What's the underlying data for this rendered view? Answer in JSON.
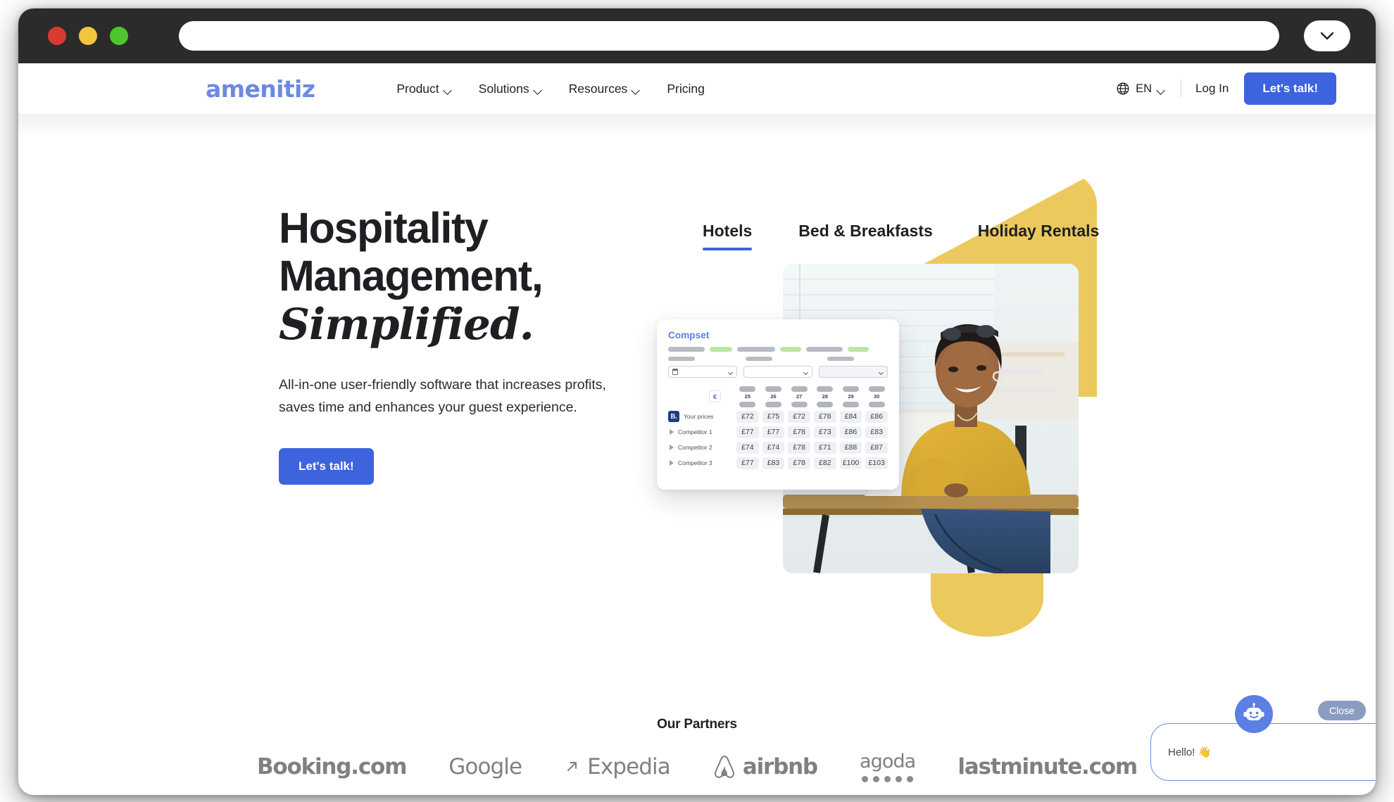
{
  "browser": {
    "traffic_lights": [
      "close",
      "minimize",
      "maximize"
    ],
    "url_value": "",
    "url_placeholder": "",
    "expand_icon": "chevron-down-icon"
  },
  "header": {
    "logo_text": "amenitiz",
    "nav": [
      {
        "label": "Product",
        "has_caret": true
      },
      {
        "label": "Solutions",
        "has_caret": true
      },
      {
        "label": "Resources",
        "has_caret": true
      },
      {
        "label": "Pricing",
        "has_caret": false
      }
    ],
    "language": {
      "icon": "globe-icon",
      "label": "EN",
      "has_caret": true
    },
    "login_label": "Log In",
    "cta_label": "Let's talk!"
  },
  "hero": {
    "headline_line1": "Hospitality",
    "headline_line2": "Management,",
    "headline_line3": "Simplified.",
    "subhead": "All-in-one user-friendly software that increases profits, saves time and enhances your guest experience.",
    "cta_label": "Let's talk!",
    "tabs": [
      {
        "label": "Hotels",
        "active": true
      },
      {
        "label": "Bed & Breakfasts",
        "active": false
      },
      {
        "label": "Holiday Rentals",
        "active": false
      }
    ]
  },
  "compset": {
    "title": "Compset",
    "currency_symbol": "€",
    "day_columns": [
      "25",
      "26",
      "27",
      "28",
      "29",
      "30"
    ],
    "rows": [
      {
        "label": "Your prices",
        "icon": "booking-b-logo",
        "prices": [
          "£72",
          "£75",
          "£72",
          "£78",
          "£84",
          "£86"
        ]
      },
      {
        "label": "Competitor 1",
        "icon": "triangle-expand-icon",
        "prices": [
          "£77",
          "£77",
          "£78",
          "£73",
          "£86",
          "£83"
        ]
      },
      {
        "label": "Competitor 2",
        "icon": "triangle-expand-icon",
        "prices": [
          "£74",
          "£74",
          "£78",
          "£71",
          "£88",
          "£87"
        ]
      },
      {
        "label": "Competitor 3",
        "icon": "triangle-expand-icon",
        "prices": [
          "£77",
          "£83",
          "£78",
          "£82",
          "£100",
          "£103"
        ]
      }
    ]
  },
  "partners": {
    "title": "Our Partners",
    "logos": [
      {
        "name": "Booking.com",
        "style": "bold"
      },
      {
        "name": "Google",
        "style": "light"
      },
      {
        "name": "Expedia",
        "style": "light",
        "icon": "arrow-up-right-icon"
      },
      {
        "name": "airbnb",
        "style": "bold",
        "icon": "airbnb-belo-icon"
      },
      {
        "name": "agoda",
        "style": "light",
        "icon": "agoda-dots"
      },
      {
        "name": "lastminute.com",
        "style": "bold"
      }
    ]
  },
  "chat": {
    "avatar_icon": "robot-icon",
    "close_label": "Close",
    "message": "Hello! 👋"
  },
  "colors": {
    "brand_blue": "#3d63dd",
    "logo_blue": "#6c8ae4",
    "accent_yellow": "#ecc95c",
    "text_dark": "#1e1f23",
    "titlebar": "#2b2b2b",
    "partner_gray": "#808080"
  }
}
